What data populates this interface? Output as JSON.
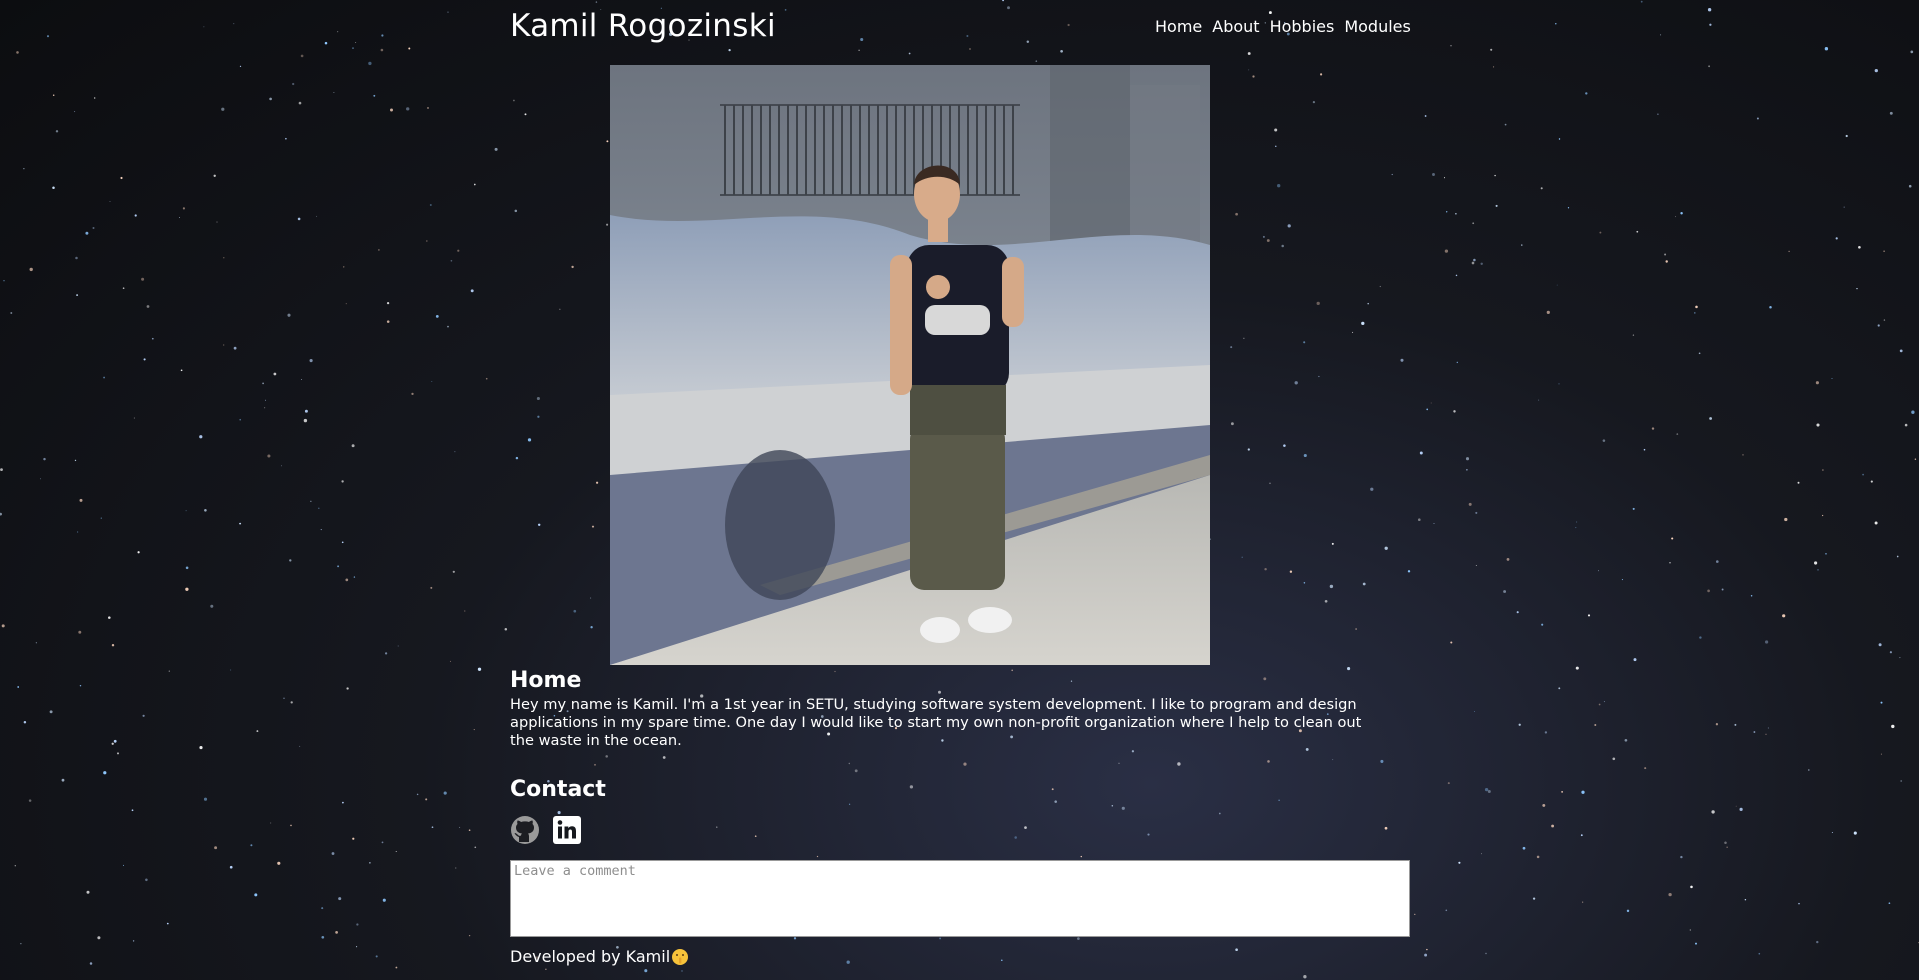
{
  "header": {
    "site_title": "Kamil Rogozinski",
    "nav": [
      {
        "label": "Home"
      },
      {
        "label": "About"
      },
      {
        "label": "Hobbies"
      },
      {
        "label": "Modules"
      }
    ]
  },
  "home": {
    "heading": "Home",
    "text": "Hey my name is Kamil. I'm a 1st year in SETU, studying software system development. I like to program and design applications in my spare time. One day I would like to start my own non-profit organization where I help to clean out the waste in the ocean."
  },
  "contact": {
    "heading": "Contact",
    "icons": [
      "github-icon",
      "linkedin-icon"
    ]
  },
  "comment": {
    "placeholder": "Leave a comment",
    "value": ""
  },
  "footer": {
    "text": "Developed by Kamil",
    "emoji_icon": "shushing-face-icon"
  },
  "colors": {
    "text": "#ffffff",
    "background": "#121318"
  }
}
